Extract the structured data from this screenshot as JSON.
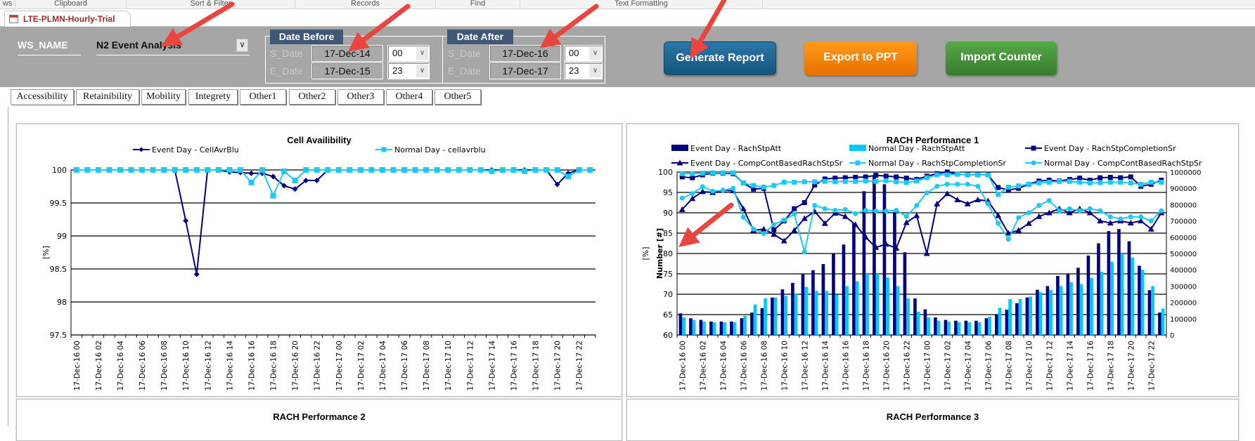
{
  "ribbon": {
    "groups": [
      "ws",
      "Clipboard",
      "Sort & Filter",
      "Records",
      "Find",
      "Text Formatting"
    ]
  },
  "document_tab": {
    "title": "LTE-PLMN-Hourly-Trial"
  },
  "header": {
    "ws_name_label": "WS_NAME",
    "ws_name_value": "N2 Event Analysis",
    "date_before": {
      "title": "Date Before",
      "s_label": "S_Date",
      "s_date": "17-Dec-14",
      "s_hour": "00",
      "e_label": "E_Date",
      "e_date": "17-Dec-15",
      "e_hour": "23"
    },
    "date_after": {
      "title": "Date After",
      "s_label": "S_Date",
      "s_date": "17-Dec-16",
      "s_hour": "00",
      "e_label": "E_Date",
      "e_date": "17-Dec-17",
      "e_hour": "23"
    },
    "buttons": {
      "generate": "Generate Report",
      "export": "Export to PPT",
      "import": "Import Counter"
    },
    "colors": {
      "generate": "#1d5d88",
      "export": "#f07c00",
      "import": "#3f8c36",
      "group_title": "#3f5877"
    }
  },
  "tabs": [
    "Accessibility",
    "Retainibility",
    "Mobility",
    "Integrety",
    "Other1",
    "Other2",
    "Other3",
    "Other4",
    "Other5"
  ],
  "active_tab": "Accessibility",
  "chart_titles_bottom": [
    "RACH Performance 2",
    "RACH Performance 3"
  ],
  "chart_data": [
    {
      "type": "line",
      "title": "Cell Availibility",
      "ylabel": "[%]",
      "ylim": [
        97.5,
        100
      ],
      "ystep": 0.5,
      "y_tick_labels": [
        "97.5",
        "98",
        "98.5",
        "99",
        "99.5",
        "100"
      ],
      "points_per_series": 48,
      "x_tick_labels": [
        "17-Dec-16 00",
        "17-Dec-16 02",
        "17-Dec-16 04",
        "17-Dec-16 06",
        "17-Dec-16 08",
        "17-Dec-16 10",
        "17-Dec-16 12",
        "17-Dec-16 14",
        "17-Dec-16 16",
        "17-Dec-16 18",
        "17-Dec-16 20",
        "17-Dec-16 22",
        "17-Dec-17 00",
        "17-Dec-17 02",
        "17-Dec-17 04",
        "17-Dec-17 06",
        "17-Dec-17 08",
        "17-Dec-17 10",
        "17-Dec-17 12",
        "17-Dec-17 14",
        "17-Dec-17 16",
        "17-Dec-17 18",
        "17-Dec-17 20",
        "17-Dec-17 22"
      ],
      "grid": true,
      "legend": "top",
      "series": [
        {
          "name": "Event Day - CellAvrBlu",
          "color": "#000080",
          "marker": "diamond",
          "values": [
            100,
            100,
            100,
            100,
            100,
            100,
            100,
            100,
            100,
            100,
            99.23,
            98.42,
            100,
            100,
            99.97,
            99.96,
            99.95,
            99.95,
            99.9,
            99.76,
            99.71,
            99.84,
            99.84,
            100,
            100,
            100,
            100,
            100,
            100,
            100,
            100,
            100,
            100,
            100,
            100,
            100,
            100,
            100,
            100,
            100,
            100,
            100,
            100,
            100,
            99.78,
            99.95,
            100,
            100
          ]
        },
        {
          "name": "Normal Day - cellavrblu",
          "color": "#1ec8f5",
          "marker": "square",
          "values": [
            100,
            100,
            100,
            100,
            100,
            100,
            100,
            100,
            100,
            100,
            100,
            100,
            100,
            100,
            100,
            100,
            99.81,
            100,
            99.61,
            99.98,
            99.84,
            100,
            100,
            100,
            100,
            100,
            100,
            100,
            100,
            100,
            100,
            100,
            100,
            100,
            100,
            100,
            100,
            100,
            99.98,
            100,
            100,
            99.98,
            100,
            100,
            100,
            99.9,
            100,
            100
          ]
        }
      ]
    },
    {
      "type": "bar+line",
      "title": "RACH Performance 1",
      "ylabel": "[%]",
      "y2label": "Number [#]",
      "ylim": [
        60,
        100
      ],
      "ystep": 5,
      "y_tick_labels": [
        "60",
        "65",
        "70",
        "75",
        "80",
        "85",
        "90",
        "95",
        "100"
      ],
      "y2lim": [
        0,
        1000000
      ],
      "y2step": 100000,
      "y2_tick_labels": [
        "0",
        "100000",
        "200000",
        "300000",
        "400000",
        "500000",
        "600000",
        "700000",
        "800000",
        "900000",
        "1000000"
      ],
      "points_per_series": 48,
      "x_tick_labels": [
        "17-Dec-16 00",
        "17-Dec-16 02",
        "17-Dec-16 04",
        "17-Dec-16 06",
        "17-Dec-16 08",
        "17-Dec-16 10",
        "17-Dec-16 12",
        "17-Dec-16 14",
        "17-Dec-16 16",
        "17-Dec-16 18",
        "17-Dec-16 20",
        "17-Dec-16 22",
        "17-Dec-17 00",
        "17-Dec-17 02",
        "17-Dec-17 04",
        "17-Dec-17 06",
        "17-Dec-17 08",
        "17-Dec-17 10",
        "17-Dec-17 12",
        "17-Dec-17 14",
        "17-Dec-17 16",
        "17-Dec-17 18",
        "17-Dec-17 20",
        "17-Dec-17 22"
      ],
      "grid": true,
      "legend": "top",
      "series": [
        {
          "name": "Event Day - RachStpAtt",
          "kind": "bar",
          "axis": "y2",
          "color": "#000080",
          "values": [
            132500,
            102500,
            92500,
            82500,
            82500,
            82500,
            102500,
            137500,
            165000,
            230000,
            280000,
            320000,
            375000,
            397500,
            435000,
            497500,
            555000,
            687500,
            882500,
            975000,
            925000,
            755000,
            507500,
            225000,
            157500,
            107500,
            92500,
            87500,
            87500,
            87500,
            102500,
            127500,
            155000,
            195000,
            230000,
            277500,
            300000,
            362500,
            375000,
            412500,
            487500,
            562500,
            637500,
            650000,
            575000,
            425000,
            275000,
            137500
          ]
        },
        {
          "name": "Normal Day - RachStpAtt",
          "kind": "bar",
          "axis": "y2",
          "color": "#00c8f8",
          "values": [
            107500,
            92500,
            82500,
            77500,
            77500,
            77500,
            117500,
            187500,
            225000,
            230000,
            240000,
            255000,
            295000,
            270000,
            270000,
            247500,
            300000,
            330000,
            375000,
            375000,
            352500,
            300000,
            225000,
            142500,
            107500,
            87500,
            82500,
            77500,
            77500,
            77500,
            112500,
            167500,
            220000,
            220000,
            235000,
            262500,
            275000,
            300000,
            325000,
            312500,
            350000,
            387500,
            450000,
            500000,
            475000,
            400000,
            300000,
            162500
          ]
        },
        {
          "name": "Event Day - RachStpCompletionSr",
          "kind": "line",
          "axis": "y",
          "color": "#000080",
          "marker": "square",
          "values": [
            98.8,
            98.6,
            99.3,
            99.7,
            99.7,
            99.6,
            97.3,
            95.8,
            96.0,
            85.8,
            88.0,
            91.0,
            92.5,
            96.8,
            98.3,
            98.5,
            98.6,
            98.7,
            98.8,
            99.2,
            99.0,
            98.8,
            98.5,
            98.2,
            99.0,
            99.6,
            100,
            99.5,
            99.3,
            99.4,
            99.3,
            96.2,
            95.6,
            96.0,
            97.0,
            97.8,
            98.0,
            97.8,
            98.2,
            98.5,
            98.0,
            98.6,
            98.7,
            98.6,
            98.8,
            96.5,
            97.0,
            98.0
          ]
        },
        {
          "name": "Event Day - CompContBasedRachStpSr",
          "kind": "line",
          "axis": "y",
          "color": "#000080",
          "marker": "triangle",
          "values": [
            90.8,
            93.5,
            95.2,
            95.0,
            95.5,
            95.4,
            91.0,
            85.7,
            86.0,
            84.7,
            83.1,
            85.7,
            88.6,
            90.3,
            87.4,
            89.9,
            89.1,
            87.1,
            84.0,
            81.5,
            82.3,
            81.3,
            87.6,
            89.3,
            80.0,
            92.2,
            94.7,
            93.2,
            92.2,
            93.2,
            92.9,
            89.3,
            85.0,
            85.7,
            87.4,
            89.1,
            90.0,
            91.0,
            90.0,
            91.0,
            90.0,
            88.0,
            87.5,
            88.0,
            87.5,
            88.0,
            86.0,
            90.0
          ]
        },
        {
          "name": "Normal Day - RachStpCompletionSr",
          "kind": "line",
          "axis": "y",
          "color": "#1ec8f5",
          "marker": "square",
          "values": [
            99.6,
            99.6,
            99.7,
            99.8,
            99.8,
            99.8,
            97.3,
            96.7,
            96.3,
            96.7,
            97.5,
            97.5,
            97.6,
            97.6,
            97.7,
            97.6,
            97.7,
            97.7,
            97.8,
            97.7,
            97.9,
            97.6,
            97.4,
            97.8,
            98.6,
            99.3,
            99.3,
            99.5,
            99.3,
            99.3,
            99.3,
            94.5,
            96.3,
            96.6,
            97.0,
            97.3,
            97.5,
            97.7,
            97.7,
            97.5,
            97.3,
            97.4,
            97.5,
            97.5,
            97.3,
            97.0,
            97.5,
            97.5
          ]
        },
        {
          "name": "Normal Day - CompContBasedRachStpSr",
          "kind": "line",
          "axis": "y",
          "color": "#1ec8f5",
          "marker": "circle",
          "values": [
            93.6,
            94.7,
            96.4,
            95.3,
            95.5,
            96.0,
            88.9,
            86.0,
            84.9,
            87.1,
            88.2,
            89.7,
            80.4,
            91.8,
            91.0,
            90.6,
            90.8,
            89.8,
            90.6,
            90.4,
            90.4,
            90.6,
            89.1,
            91.8,
            94.9,
            96.5,
            97.0,
            97.0,
            97.0,
            96.5,
            92.2,
            87.4,
            83.5,
            88.8,
            90.0,
            91.8,
            93.0,
            90.5,
            91.0,
            90.5,
            91.0,
            90.5,
            89.0,
            88.5,
            89.0,
            89.0,
            88.0,
            90.5
          ]
        }
      ]
    }
  ]
}
